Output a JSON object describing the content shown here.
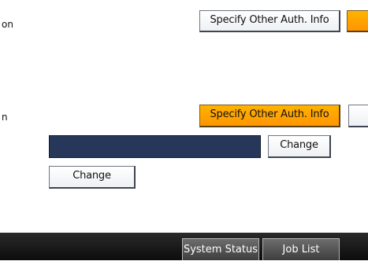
{
  "row1": {
    "label": "on",
    "button": "Specify Other Auth. Info"
  },
  "row2": {
    "label": "n",
    "button": "Specify Other Auth. Info"
  },
  "field": {
    "value": "",
    "change_label": "Change"
  },
  "change2": {
    "label": "Change"
  },
  "footer": {
    "system_status": "System Status",
    "job_list": "Job List"
  },
  "colors": {
    "selected": "#ffa500",
    "field": "#27375a",
    "bar": "#1a1a1a"
  }
}
